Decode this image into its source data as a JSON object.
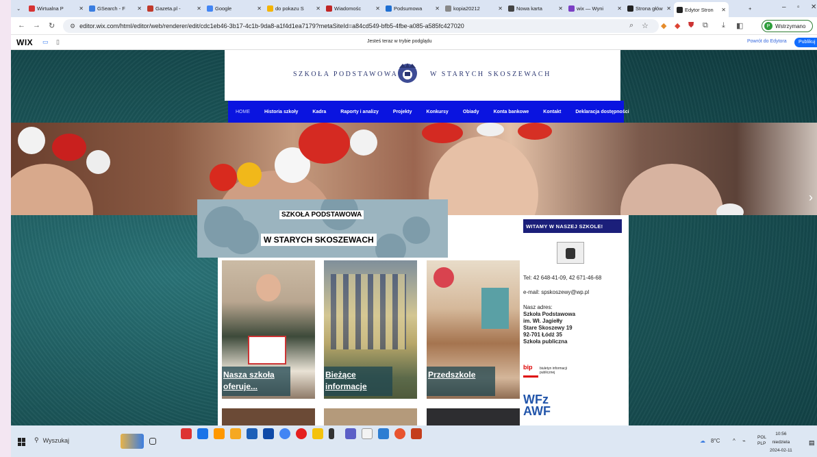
{
  "browser": {
    "tabs": [
      {
        "label": "Wirtualna P",
        "color": "#d63333"
      },
      {
        "label": "GSearch - F",
        "color": "#3a7de0"
      },
      {
        "label": "Gazeta.pl -",
        "color": "#c0392b"
      },
      {
        "label": "Google",
        "color": "#4285f4"
      },
      {
        "label": "do pokazu S",
        "color": "#f4b400"
      },
      {
        "label": "Wiadomośc",
        "color": "#c02626"
      },
      {
        "label": "Podsumowa",
        "color": "#1f6fd1"
      },
      {
        "label": "kopia20212",
        "color": "#888888"
      },
      {
        "label": "Nowa karta",
        "color": "#444444"
      },
      {
        "label": "wix — Wyni",
        "color": "#7b3fc4"
      },
      {
        "label": "Strona głów",
        "color": "#222222"
      },
      {
        "label": "Edytor Stron",
        "color": "#222222"
      }
    ],
    "url": "editor.wix.com/html/editor/web/renderer/edit/cdc1eb46-3b17-4c1b-9da8-a1f4d1ea7179?metaSiteId=a84cd549-bfb5-4fbe-a085-a585fc427020",
    "profile": "Wstrzymano"
  },
  "wix": {
    "logo": "WIX",
    "preview_msg": "Jesteś teraz w trybie podglądu",
    "back": "Powrót do Edytora",
    "publish": "Publikuj"
  },
  "site": {
    "header_left": "SZKOŁA PODSTAWOWA",
    "header_right": "W STARYCH SKOSZEWACH",
    "menu": [
      "HOME",
      "Historia szkoły",
      "Kadra",
      "Raporty i analizy",
      "Projekty",
      "Konkursy",
      "Obiady",
      "Konta bankowe",
      "Kontakt",
      "Deklaracja dostępności"
    ],
    "title_line1": "SZKOŁA PODSTAWOWA",
    "title_line2": "W STARYCH SKOSZEWACH",
    "cards": [
      {
        "caption_l1": "Nasza szkoła",
        "caption_l2": "oferuje..."
      },
      {
        "caption_l1": "Bieżące",
        "caption_l2": "informacje"
      },
      {
        "caption_l1": "Przedszkole",
        "caption_l2": ""
      }
    ],
    "sidebar": {
      "welcome": "WITAMY W NASZEJ SZKOLE!",
      "tel": "Tel:  42 648-41-09, 42 671-46-68",
      "email": "e-mail: spskoszewy@wp.pl",
      "address_label": "Nasz adres:",
      "address": [
        "Szkoła Podstawowa",
        "im. Wł. Jagiełły",
        "Stare Skoszewy 19",
        "92-701 Łódź 35",
        "Szkoła publiczna"
      ],
      "bip_text": "biuletyn informacji publicznej",
      "bip": "bip",
      "wfz_l1": "WFz",
      "wfz_l2": "AWF"
    }
  },
  "taskbar": {
    "search": "Wyszukaj",
    "temp": "8°C",
    "lang1": "POL",
    "lang2": "PLP",
    "time": "10:56",
    "day": "niedziela",
    "date": "2024-02-11"
  }
}
